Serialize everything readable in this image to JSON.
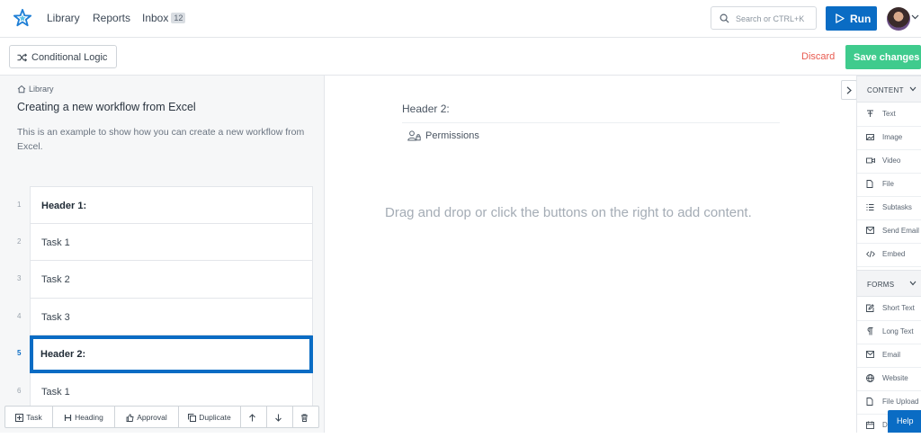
{
  "nav": {
    "library": "Library",
    "reports": "Reports",
    "inbox": "Inbox",
    "inbox_count": "12"
  },
  "search": {
    "placeholder": "Search or CTRL+K"
  },
  "run_label": "Run",
  "toolbar": {
    "conditional_logic": "Conditional Logic",
    "discard": "Discard",
    "save": "Save changes"
  },
  "breadcrumb": "Library",
  "workflow": {
    "title": "Creating a new workflow from Excel",
    "description": "This is an example to show how you can create a new workflow from Excel."
  },
  "tasks": [
    {
      "num": "1",
      "label": "Header 1:"
    },
    {
      "num": "2",
      "label": "Task 1"
    },
    {
      "num": "3",
      "label": "Task 2"
    },
    {
      "num": "4",
      "label": "Task 3"
    },
    {
      "num": "5",
      "label": "Header 2:"
    },
    {
      "num": "6",
      "label": "Task 1"
    }
  ],
  "bottom_toolbar": {
    "task": "Task",
    "heading": "Heading",
    "approval": "Approval",
    "duplicate": "Duplicate"
  },
  "center": {
    "header": "Header 2:",
    "permissions": "Permissions",
    "drop_hint": "Drag and drop or click the buttons on the right to add content."
  },
  "content_panel": {
    "content_title": "CONTENT",
    "content_items": [
      "Text",
      "Image",
      "Video",
      "File",
      "Subtasks",
      "Send Email",
      "Embed"
    ],
    "forms_title": "FORMS",
    "form_items": [
      "Short Text",
      "Long Text",
      "Email",
      "Website",
      "File Upload",
      "D"
    ]
  },
  "help_label": "Help"
}
